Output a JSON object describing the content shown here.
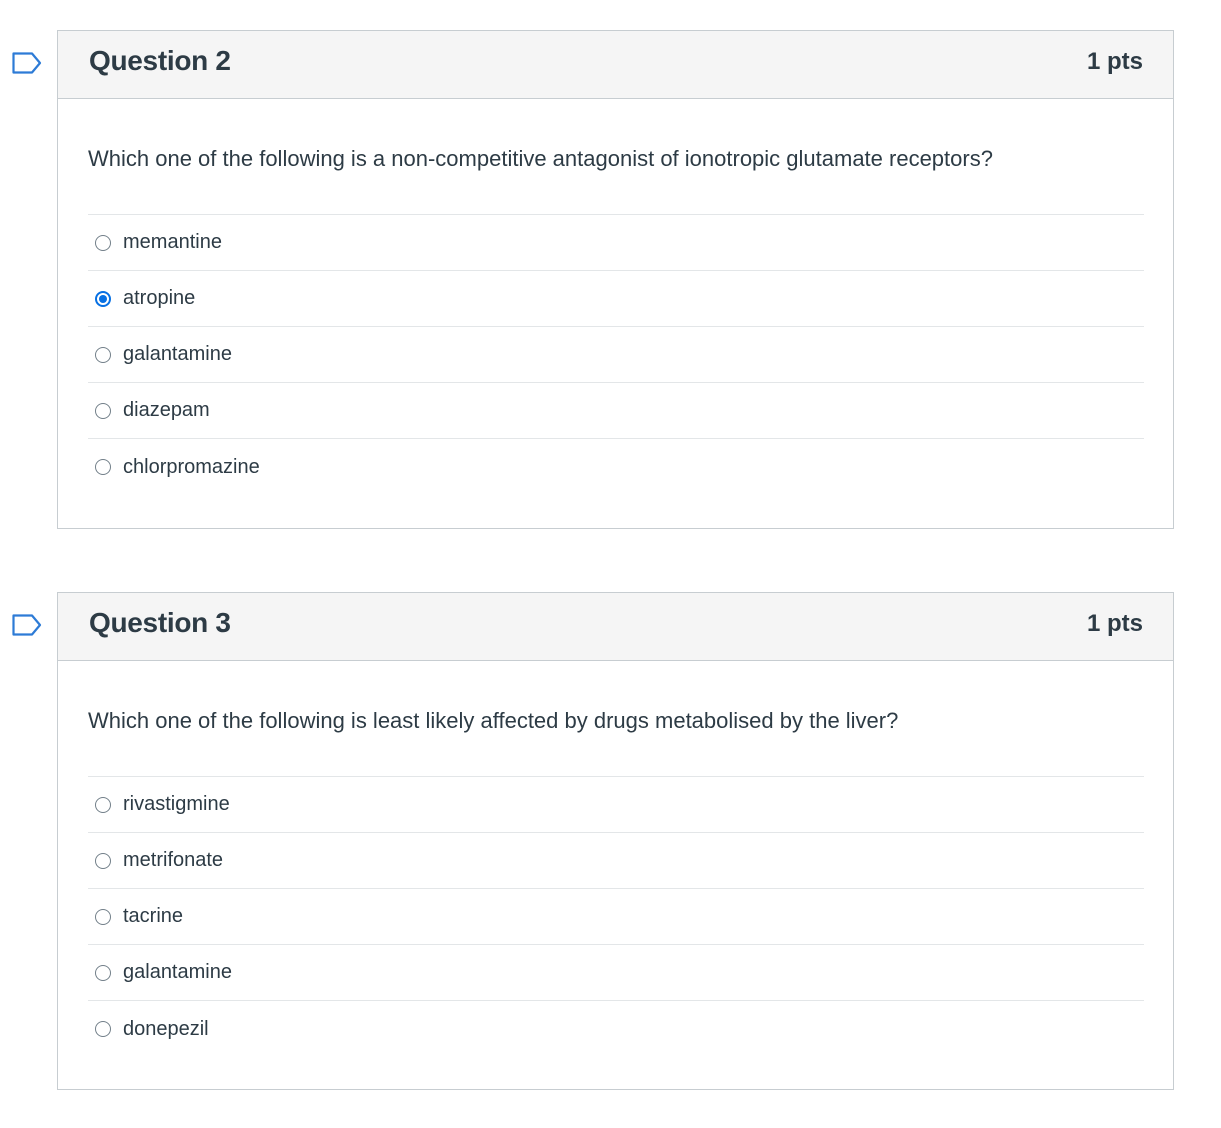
{
  "questions": [
    {
      "title": "Question 2",
      "points": "1 pts",
      "text": "Which one of the following is a non-competitive antagonist of ionotropic glutamate receptors?",
      "options": [
        {
          "label": "memantine",
          "selected": false
        },
        {
          "label": "atropine",
          "selected": true
        },
        {
          "label": "galantamine",
          "selected": false
        },
        {
          "label": "diazepam",
          "selected": false
        },
        {
          "label": "chlorpromazine",
          "selected": false
        }
      ]
    },
    {
      "title": "Question 3",
      "points": "1 pts",
      "text": "Which one of the following is least likely affected by drugs metabolised by the liver?",
      "options": [
        {
          "label": "rivastigmine",
          "selected": false
        },
        {
          "label": "metrifonate",
          "selected": false
        },
        {
          "label": "tacrine",
          "selected": false
        },
        {
          "label": "galantamine",
          "selected": false
        },
        {
          "label": "donepezil",
          "selected": false
        }
      ]
    }
  ],
  "colors": {
    "accent": "#0770e3",
    "flag": "#2d7bd6",
    "header_bg": "#f5f5f5",
    "border": "#c7cdd1",
    "text": "#2d3b45"
  },
  "icons": {
    "flag": "bookmark-flag-icon",
    "radio": "radio-button"
  }
}
